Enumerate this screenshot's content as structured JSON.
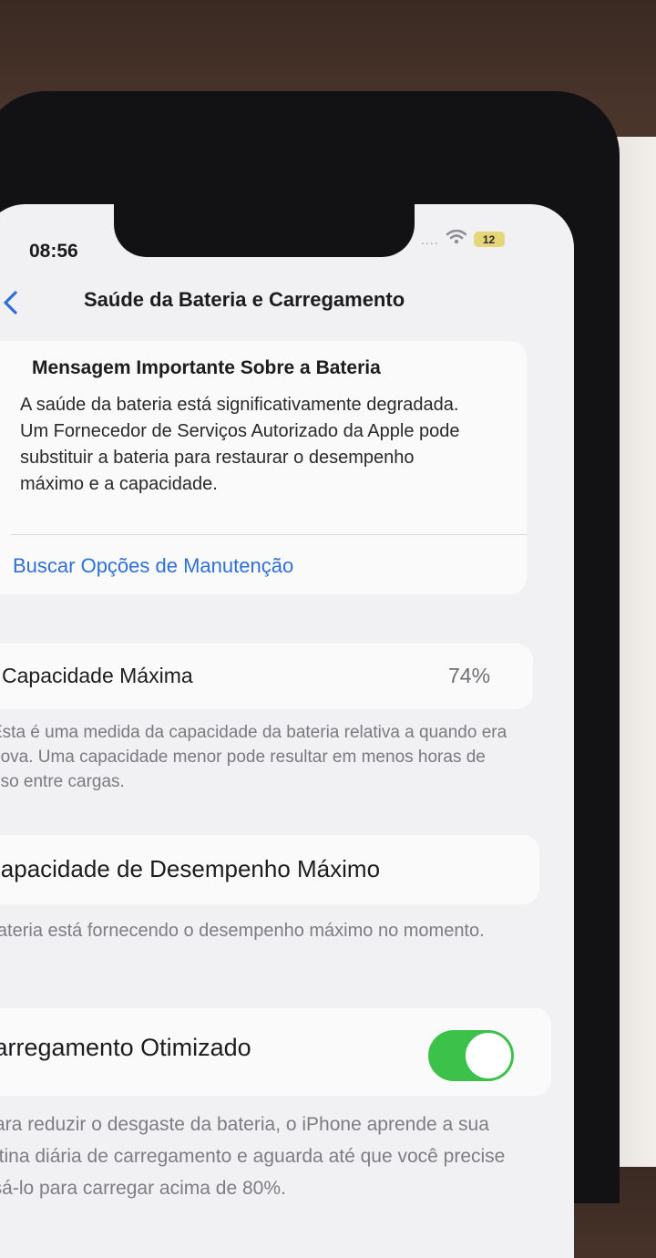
{
  "status_bar": {
    "time": "08:56",
    "signal": "....",
    "battery_level": "12"
  },
  "nav": {
    "back_icon": "chevron-left-icon",
    "title": "Saúde da Bateria e Carregamento"
  },
  "battery_message": {
    "title": "Mensagem Importante Sobre a Bateria",
    "body": "A saúde da bateria está significativamente degradada. Um Fornecedor de Serviços Autorizado da Apple pode substituir a bateria para restaurar o desempenho máximo e a capacidade.",
    "link": "Buscar Opções de Manutenção"
  },
  "max_capacity": {
    "label": "Capacidade Máxima",
    "value": "74%",
    "note": "Esta é uma medida da capacidade da bateria relativa a quando era nova. Uma capacidade menor pode resultar em menos horas de uso entre cargas."
  },
  "peak_performance": {
    "label": "Capacidade de Desempenho Máximo",
    "note": "A bateria está fornecendo o desempenho máximo no momento."
  },
  "optimized_charging": {
    "label": "Carregamento Otimizado",
    "enabled": true,
    "note": "Para reduzir o desgaste da bateria, o iPhone aprende a sua rotina diária de carregamento e aguarda até que você precise usá-lo para carregar acima de 80%."
  },
  "colors": {
    "accent": "#2e6fd8",
    "toggle_on": "#3cc24a"
  }
}
